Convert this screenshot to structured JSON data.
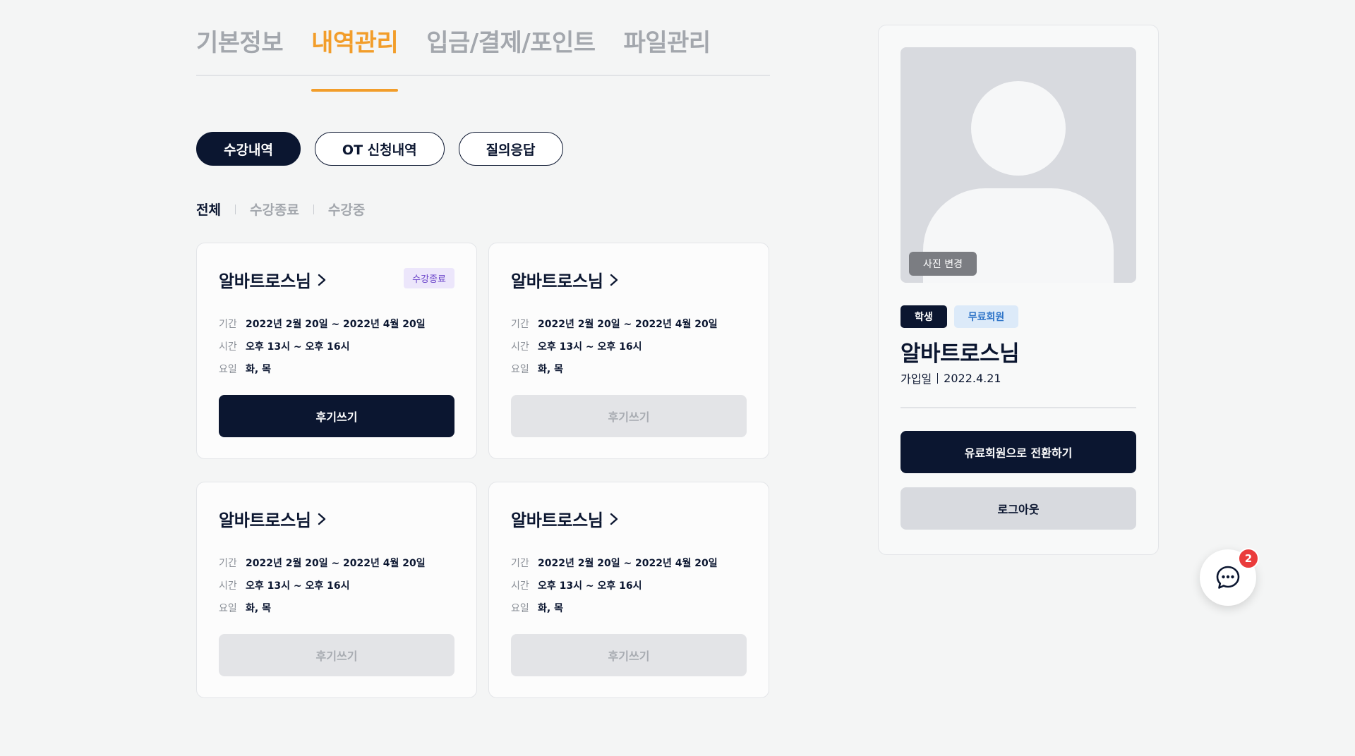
{
  "main_tabs": [
    "기본정보",
    "내역관리",
    "입금/결제/포인트",
    "파일관리"
  ],
  "sub_tabs": [
    "수강내역",
    "OT 신청내역",
    "질의응답"
  ],
  "filters": [
    "전체",
    "수강종료",
    "수강중"
  ],
  "card_labels": {
    "period": "기간",
    "time": "시간",
    "days": "요일"
  },
  "cards": [
    {
      "title": "알바트로스님",
      "badge": "수강종료",
      "period": "2022년 2월 20일 ~ 2022년 4월 20일",
      "time": "오후 13시 ~ 오후 16시",
      "days": "화, 목",
      "button": "후기쓰기"
    },
    {
      "title": "알바트로스님",
      "badge": "",
      "period": "2022년 2월 20일 ~ 2022년 4월 20일",
      "time": "오후 13시 ~ 오후 16시",
      "days": "화, 목",
      "button": "후기쓰기"
    },
    {
      "title": "알바트로스님",
      "badge": "",
      "period": "2022년 2월 20일 ~ 2022년 4월 20일",
      "time": "오후 13시 ~ 오후 16시",
      "days": "화, 목",
      "button": "후기쓰기"
    },
    {
      "title": "알바트로스님",
      "badge": "",
      "period": "2022년 2월 20일 ~ 2022년 4월 20일",
      "time": "오후 13시 ~ 오후 16시",
      "days": "화, 목",
      "button": "후기쓰기"
    }
  ],
  "profile": {
    "photo_change": "사진 변경",
    "tags": [
      "학생",
      "무료회원"
    ],
    "name": "알바트로스님",
    "join_label": "가입일",
    "join_date": "2022.4.21",
    "upgrade_button": "유료회원으로 전환하기",
    "logout_button": "로그아웃"
  },
  "chat": {
    "badge_count": "2"
  },
  "colors": {
    "navy": "#0b1630",
    "orange_accent": "#f29d2a",
    "badge_purple": "#6a44c9",
    "tag_blue": "#2e74c8",
    "notification_red": "#ea3b3b"
  },
  "icons": [
    "chevron-right-icon",
    "chat-bubble-icon",
    "avatar-placeholder-icon"
  ]
}
